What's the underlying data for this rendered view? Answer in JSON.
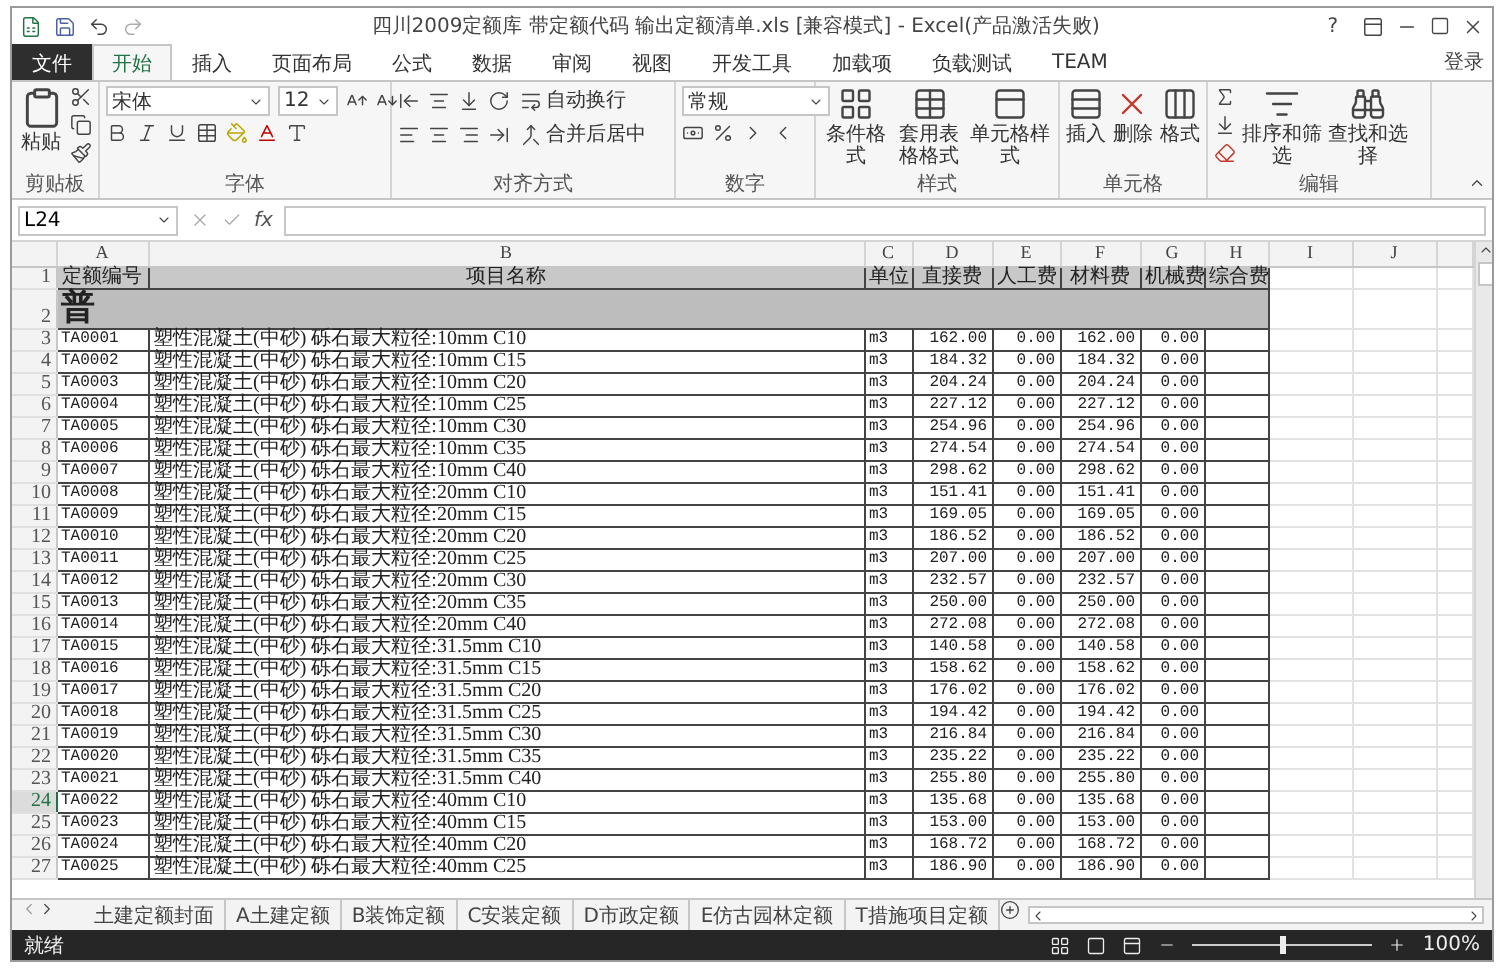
{
  "window": {
    "title": "四川2009定额库 带定额代码 输出定额清单.xls  [兼容模式] - Excel(产品激活失败)",
    "help": "?"
  },
  "ribbon_tabs": [
    {
      "label": "文件",
      "kind": "file",
      "selected": false
    },
    {
      "label": "开始",
      "kind": "tab",
      "selected": true
    },
    {
      "label": "插入",
      "kind": "tab",
      "selected": false
    },
    {
      "label": "页面布局",
      "kind": "tab",
      "selected": false
    },
    {
      "label": "公式",
      "kind": "tab",
      "selected": false
    },
    {
      "label": "数据",
      "kind": "tab",
      "selected": false
    },
    {
      "label": "审阅",
      "kind": "tab",
      "selected": false
    },
    {
      "label": "视图",
      "kind": "tab",
      "selected": false
    },
    {
      "label": "开发工具",
      "kind": "tab",
      "selected": false
    },
    {
      "label": "加载项",
      "kind": "tab",
      "selected": false
    },
    {
      "label": "负载测试",
      "kind": "tab",
      "selected": false
    },
    {
      "label": "TEAM",
      "kind": "tab",
      "selected": false
    }
  ],
  "sign_in": "登录",
  "ribbon_groups": [
    {
      "label": "剪贴板",
      "kind": "clipboard",
      "buttons": [
        "粘贴"
      ]
    },
    {
      "label": "字体",
      "kind": "font",
      "font_name": "宋体",
      "font_size": "12"
    },
    {
      "label": "对齐方式",
      "kind": "align",
      "buttons": [
        "自动换行",
        "合并后居中"
      ]
    },
    {
      "label": "数字",
      "kind": "number",
      "format": "常规"
    },
    {
      "label": "样式",
      "kind": "styles",
      "buttons": [
        "条件格式",
        "套用表格格式",
        "单元格样式"
      ]
    },
    {
      "label": "单元格",
      "kind": "cells",
      "buttons": [
        "插入",
        "删除",
        "格式"
      ]
    },
    {
      "label": "编辑",
      "kind": "editing",
      "buttons": [
        "排序和筛选",
        "查找和选择"
      ]
    }
  ],
  "formula_bar": {
    "name_box": "L24",
    "fx": "fx"
  },
  "columns": [
    {
      "letter": "A",
      "header": "定额编号"
    },
    {
      "letter": "B",
      "header": "项目名称"
    },
    {
      "letter": "C",
      "header": "单位"
    },
    {
      "letter": "D",
      "header": "直接费"
    },
    {
      "letter": "E",
      "header": "人工费"
    },
    {
      "letter": "F",
      "header": "材料费"
    },
    {
      "letter": "G",
      "header": "机械费"
    },
    {
      "letter": "H",
      "header": "综合费"
    },
    {
      "letter": "I"
    },
    {
      "letter": "J"
    }
  ],
  "header_row_number": "1",
  "section": {
    "number": "2",
    "heading": "普"
  },
  "rows": [
    {
      "number": "3",
      "code": "TA0001",
      "name": "塑性混凝土(中砂) 砾石最大粒径:10mm C10",
      "unit": "m3",
      "direct": "162.00",
      "labor": "0.00",
      "material": "162.00",
      "machine": "0.00",
      "selected": false
    },
    {
      "number": "4",
      "code": "TA0002",
      "name": "塑性混凝土(中砂) 砾石最大粒径:10mm C15",
      "unit": "m3",
      "direct": "184.32",
      "labor": "0.00",
      "material": "184.32",
      "machine": "0.00",
      "selected": false
    },
    {
      "number": "5",
      "code": "TA0003",
      "name": "塑性混凝土(中砂) 砾石最大粒径:10mm C20",
      "unit": "m3",
      "direct": "204.24",
      "labor": "0.00",
      "material": "204.24",
      "machine": "0.00",
      "selected": false
    },
    {
      "number": "6",
      "code": "TA0004",
      "name": "塑性混凝土(中砂) 砾石最大粒径:10mm C25",
      "unit": "m3",
      "direct": "227.12",
      "labor": "0.00",
      "material": "227.12",
      "machine": "0.00",
      "selected": false
    },
    {
      "number": "7",
      "code": "TA0005",
      "name": "塑性混凝土(中砂) 砾石最大粒径:10mm C30",
      "unit": "m3",
      "direct": "254.96",
      "labor": "0.00",
      "material": "254.96",
      "machine": "0.00",
      "selected": false
    },
    {
      "number": "8",
      "code": "TA0006",
      "name": "塑性混凝土(中砂) 砾石最大粒径:10mm C35",
      "unit": "m3",
      "direct": "274.54",
      "labor": "0.00",
      "material": "274.54",
      "machine": "0.00",
      "selected": false
    },
    {
      "number": "9",
      "code": "TA0007",
      "name": "塑性混凝土(中砂) 砾石最大粒径:10mm C40",
      "unit": "m3",
      "direct": "298.62",
      "labor": "0.00",
      "material": "298.62",
      "machine": "0.00",
      "selected": false
    },
    {
      "number": "10",
      "code": "TA0008",
      "name": "塑性混凝土(中砂) 砾石最大粒径:20mm C10",
      "unit": "m3",
      "direct": "151.41",
      "labor": "0.00",
      "material": "151.41",
      "machine": "0.00",
      "selected": false
    },
    {
      "number": "11",
      "code": "TA0009",
      "name": "塑性混凝土(中砂) 砾石最大粒径:20mm C15",
      "unit": "m3",
      "direct": "169.05",
      "labor": "0.00",
      "material": "169.05",
      "machine": "0.00",
      "selected": false
    },
    {
      "number": "12",
      "code": "TA0010",
      "name": "塑性混凝土(中砂) 砾石最大粒径:20mm C20",
      "unit": "m3",
      "direct": "186.52",
      "labor": "0.00",
      "material": "186.52",
      "machine": "0.00",
      "selected": false
    },
    {
      "number": "13",
      "code": "TA0011",
      "name": "塑性混凝土(中砂) 砾石最大粒径:20mm C25",
      "unit": "m3",
      "direct": "207.00",
      "labor": "0.00",
      "material": "207.00",
      "machine": "0.00",
      "selected": false
    },
    {
      "number": "14",
      "code": "TA0012",
      "name": "塑性混凝土(中砂) 砾石最大粒径:20mm C30",
      "unit": "m3",
      "direct": "232.57",
      "labor": "0.00",
      "material": "232.57",
      "machine": "0.00",
      "selected": false
    },
    {
      "number": "15",
      "code": "TA0013",
      "name": "塑性混凝土(中砂) 砾石最大粒径:20mm C35",
      "unit": "m3",
      "direct": "250.00",
      "labor": "0.00",
      "material": "250.00",
      "machine": "0.00",
      "selected": false
    },
    {
      "number": "16",
      "code": "TA0014",
      "name": "塑性混凝土(中砂) 砾石最大粒径:20mm C40",
      "unit": "m3",
      "direct": "272.08",
      "labor": "0.00",
      "material": "272.08",
      "machine": "0.00",
      "selected": false
    },
    {
      "number": "17",
      "code": "TA0015",
      "name": "塑性混凝土(中砂) 砾石最大粒径:31.5mm C10",
      "unit": "m3",
      "direct": "140.58",
      "labor": "0.00",
      "material": "140.58",
      "machine": "0.00",
      "selected": false
    },
    {
      "number": "18",
      "code": "TA0016",
      "name": "塑性混凝土(中砂) 砾石最大粒径:31.5mm C15",
      "unit": "m3",
      "direct": "158.62",
      "labor": "0.00",
      "material": "158.62",
      "machine": "0.00",
      "selected": false
    },
    {
      "number": "19",
      "code": "TA0017",
      "name": "塑性混凝土(中砂) 砾石最大粒径:31.5mm C20",
      "unit": "m3",
      "direct": "176.02",
      "labor": "0.00",
      "material": "176.02",
      "machine": "0.00",
      "selected": false
    },
    {
      "number": "20",
      "code": "TA0018",
      "name": "塑性混凝土(中砂) 砾石最大粒径:31.5mm C25",
      "unit": "m3",
      "direct": "194.42",
      "labor": "0.00",
      "material": "194.42",
      "machine": "0.00",
      "selected": false
    },
    {
      "number": "21",
      "code": "TA0019",
      "name": "塑性混凝土(中砂) 砾石最大粒径:31.5mm C30",
      "unit": "m3",
      "direct": "216.84",
      "labor": "0.00",
      "material": "216.84",
      "machine": "0.00",
      "selected": false
    },
    {
      "number": "22",
      "code": "TA0020",
      "name": "塑性混凝土(中砂) 砾石最大粒径:31.5mm C35",
      "unit": "m3",
      "direct": "235.22",
      "labor": "0.00",
      "material": "235.22",
      "machine": "0.00",
      "selected": false
    },
    {
      "number": "23",
      "code": "TA0021",
      "name": "塑性混凝土(中砂) 砾石最大粒径:31.5mm C40",
      "unit": "m3",
      "direct": "255.80",
      "labor": "0.00",
      "material": "255.80",
      "machine": "0.00",
      "selected": false
    },
    {
      "number": "24",
      "code": "TA0022",
      "name": "塑性混凝土(中砂) 砾石最大粒径:40mm C10",
      "unit": "m3",
      "direct": "135.68",
      "labor": "0.00",
      "material": "135.68",
      "machine": "0.00",
      "selected": true
    },
    {
      "number": "25",
      "code": "TA0023",
      "name": "塑性混凝土(中砂) 砾石最大粒径:40mm C15",
      "unit": "m3",
      "direct": "153.00",
      "labor": "0.00",
      "material": "153.00",
      "machine": "0.00",
      "selected": false
    },
    {
      "number": "26",
      "code": "TA0024",
      "name": "塑性混凝土(中砂) 砾石最大粒径:40mm C20",
      "unit": "m3",
      "direct": "168.72",
      "labor": "0.00",
      "material": "168.72",
      "machine": "0.00",
      "selected": false
    },
    {
      "number": "27",
      "code": "TA0025",
      "name": "塑性混凝土(中砂) 砾石最大粒径:40mm C25",
      "unit": "m3",
      "direct": "186.90",
      "labor": "0.00",
      "material": "186.90",
      "machine": "0.00",
      "selected": false
    }
  ],
  "sheet_tabs": [
    {
      "label": "土建定额封面",
      "selected": false
    },
    {
      "label": "A土建定额",
      "selected": false
    },
    {
      "label": "B装饰定额",
      "selected": false
    },
    {
      "label": "C安装定额",
      "selected": false
    },
    {
      "label": "D市政定额",
      "selected": false
    },
    {
      "label": "E仿古园林定额",
      "selected": false
    },
    {
      "label": "T措施项目定额",
      "selected": false
    }
  ],
  "status_bar": {
    "text": "就绪",
    "zoom": "100%",
    "zoom_slider": {
      "level": 0.5
    }
  }
}
